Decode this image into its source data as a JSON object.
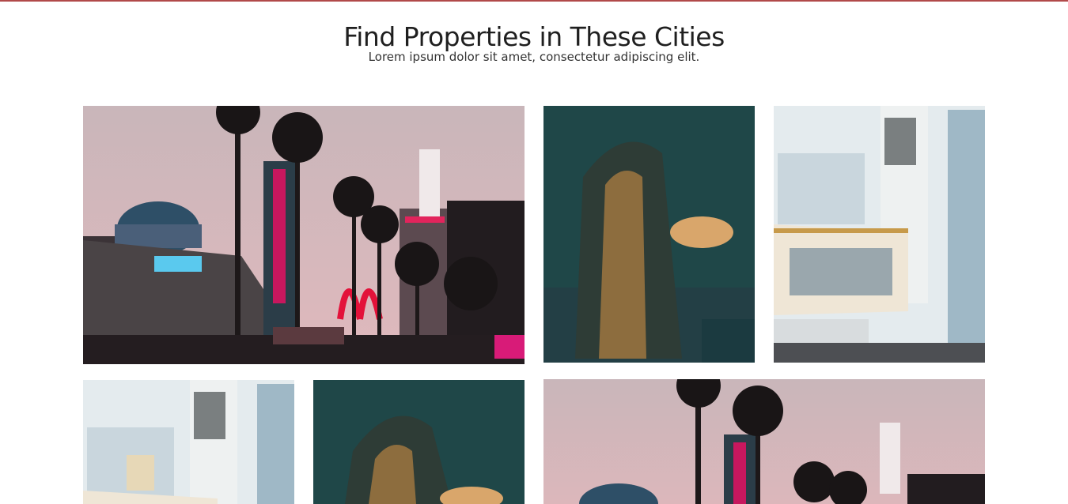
{
  "section": {
    "title": "Find Properties in These Cities",
    "subtitle": "Lorem ipsum dolor sit amet, consectetur adipiscing elit."
  },
  "cities": [
    {
      "scene": "hollywood-street",
      "name": ""
    },
    {
      "scene": "tower-at-dusk",
      "name": ""
    },
    {
      "scene": "downtown-corner",
      "name": ""
    },
    {
      "scene": "downtown-corner",
      "name": ""
    },
    {
      "scene": "tower-at-dusk",
      "name": ""
    },
    {
      "scene": "hollywood-street",
      "name": ""
    }
  ],
  "colors": {
    "accent_bar": "#b14a4a",
    "sky_pink": "#d8b7b8",
    "sky_teal": "#235a5a",
    "sky_pale": "#dfe8ec"
  }
}
